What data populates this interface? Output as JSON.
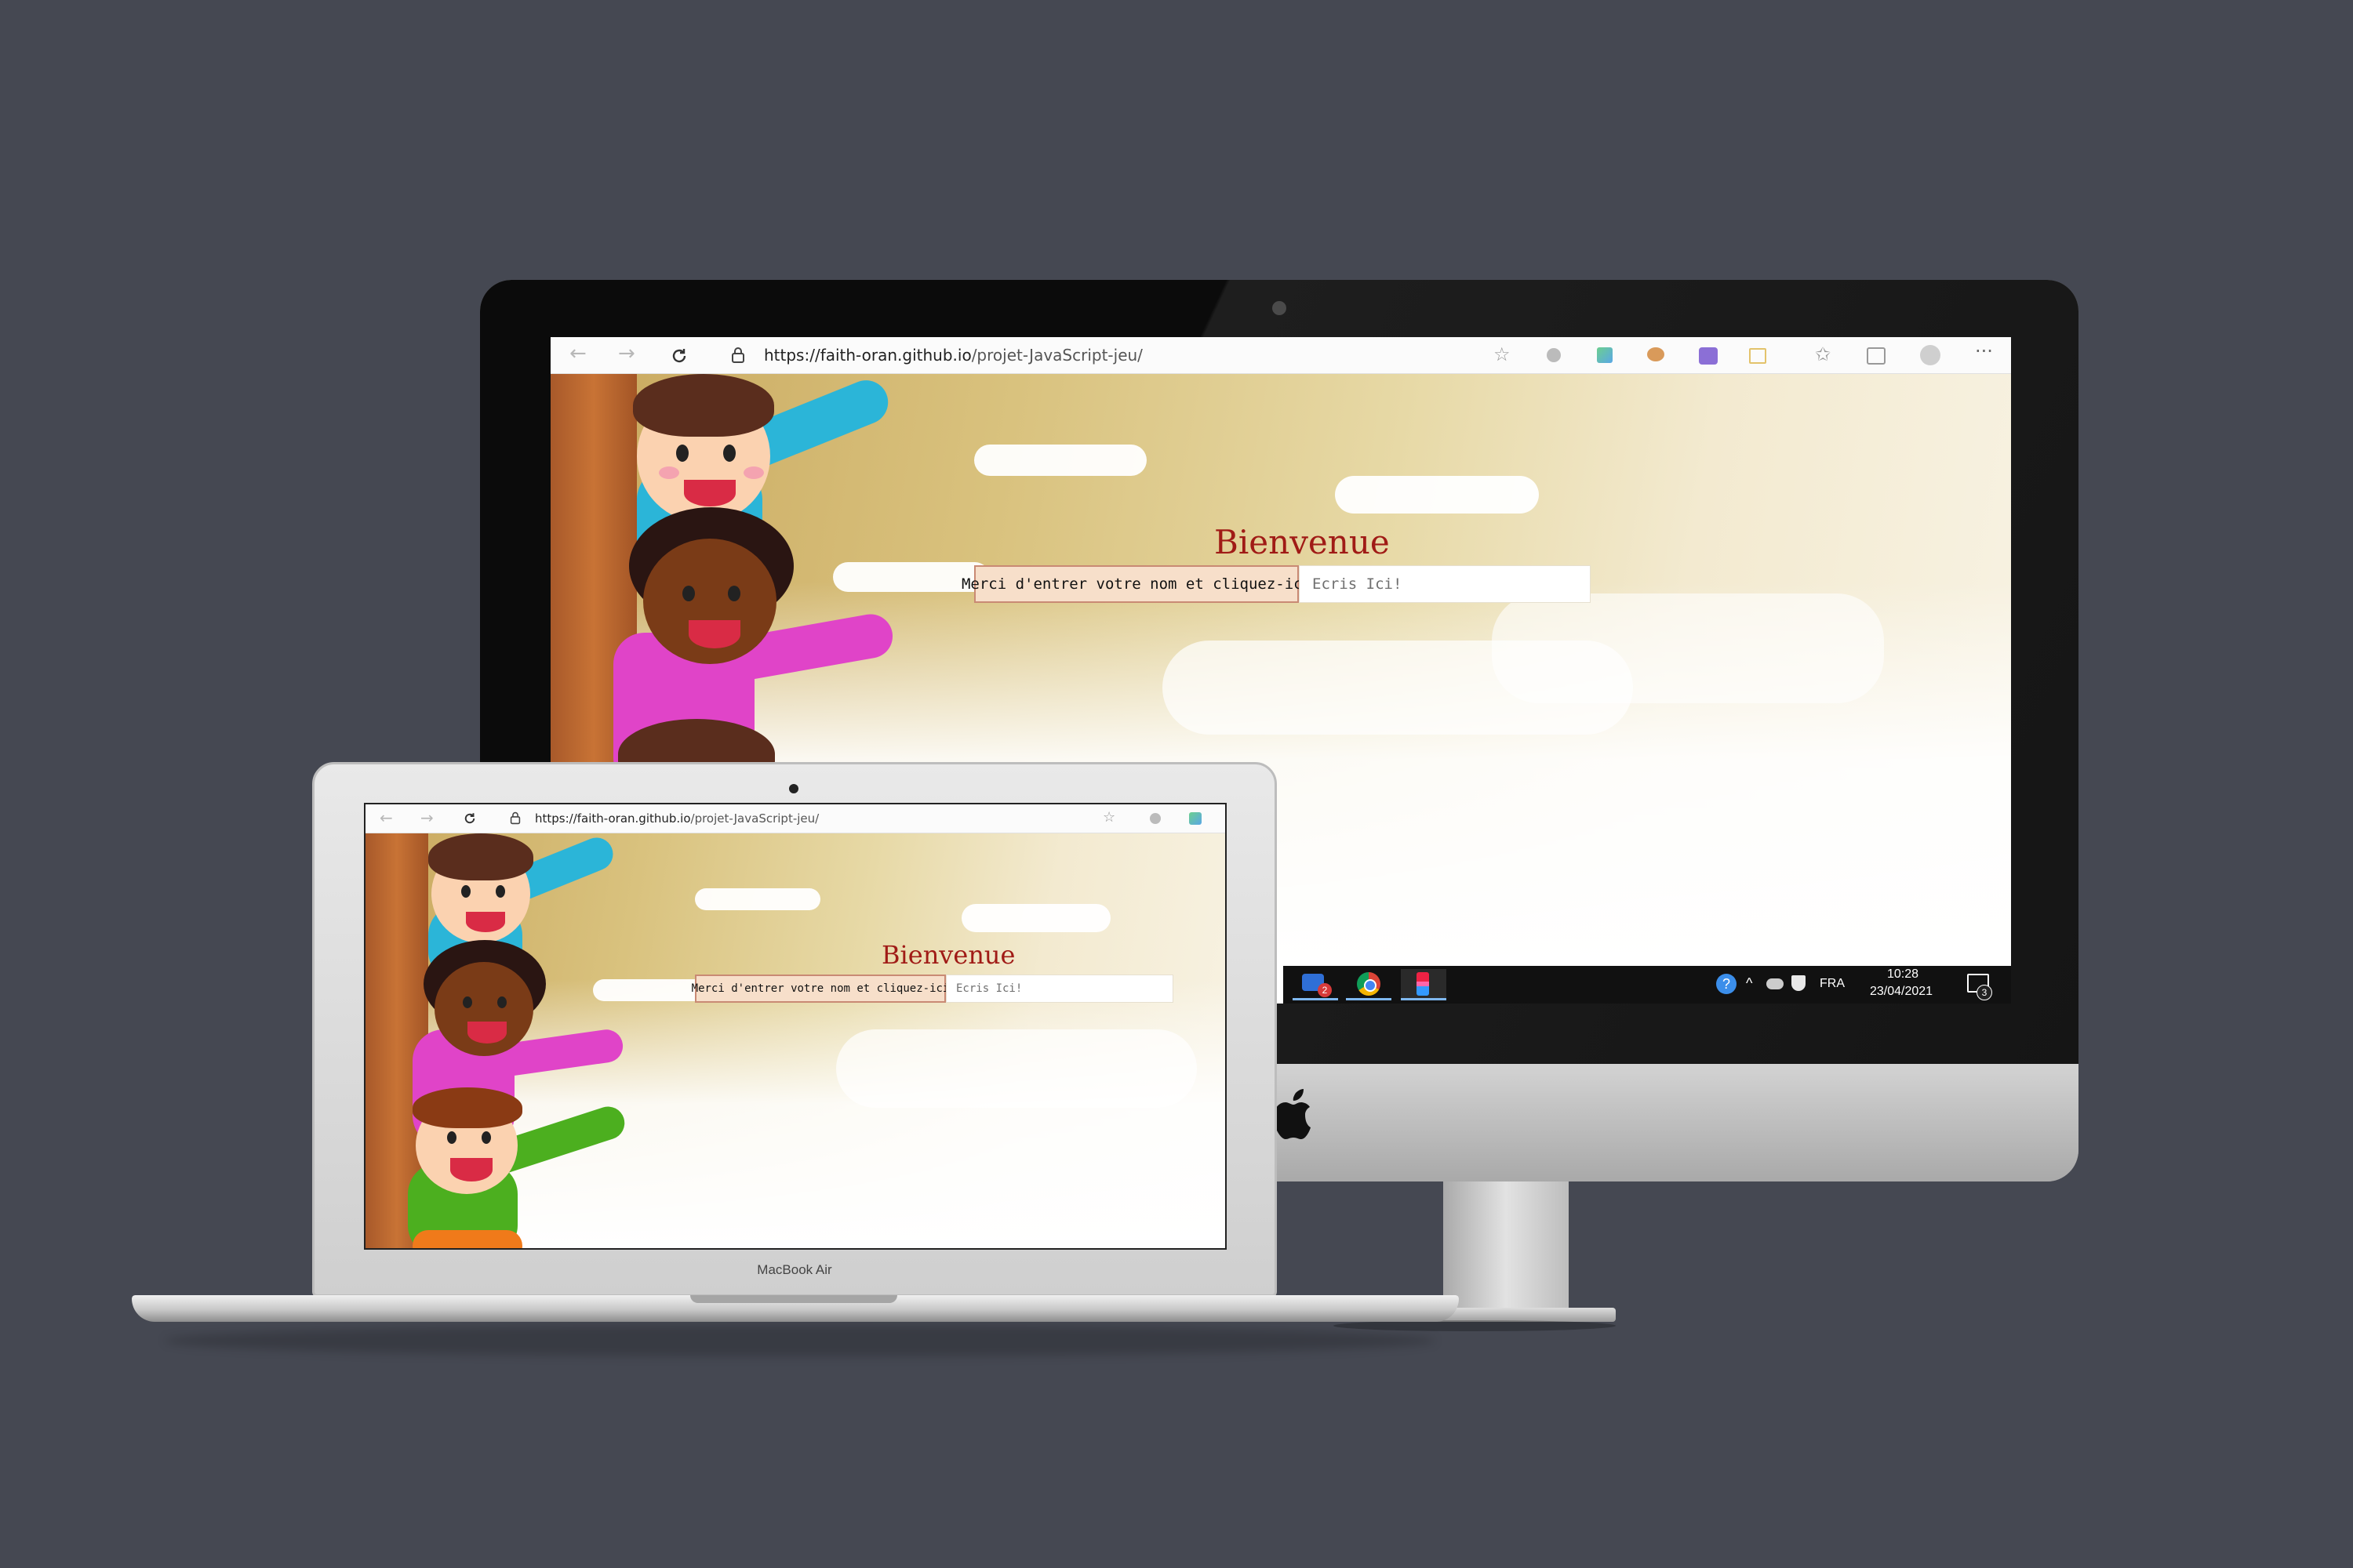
{
  "imac": {
    "browser": {
      "url_host": "https://faith-oran.github.io",
      "url_path": "/projet-JavaScript-jeu/",
      "icons": [
        "back-arrow-icon",
        "forward-arrow-icon",
        "refresh-icon",
        "lock-icon",
        "favorite-icon",
        "extension-icon",
        "collections-icon",
        "profile-icon",
        "more-icon"
      ]
    },
    "page": {
      "title": "Bienvenue",
      "button_label": "Merci d'entrer votre nom et cliquez-ici",
      "input_placeholder": "Ecris Ici!"
    },
    "taskbar": {
      "language": "FRA",
      "time": "10:28",
      "date": "23/04/2021",
      "notification_count": "3",
      "app_badge": "2"
    }
  },
  "macbook": {
    "model_label": "MacBook Air",
    "browser": {
      "url_host": "https://faith-oran.github.io",
      "url_path": "/projet-JavaScript-jeu/"
    },
    "page": {
      "title": "Bienvenue",
      "button_label": "Merci d'entrer votre nom et cliquez-ici",
      "input_placeholder": "Ecris Ici!"
    }
  },
  "colors": {
    "background": "#454852",
    "title": "#a01b16",
    "button_bg": "#f7dfca",
    "button_border": "#c98a74"
  }
}
